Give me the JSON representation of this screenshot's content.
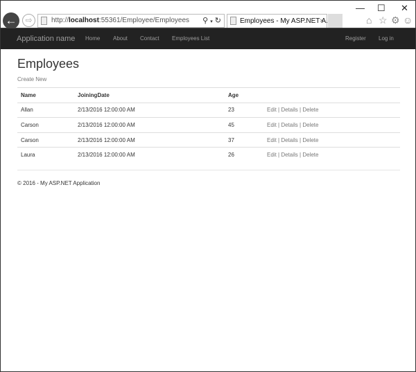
{
  "browser": {
    "url_prefix": "http://",
    "url_host": "localhost",
    "url_rest": ":55361/Employee/Employees",
    "tab_title": "Employees - My ASP.NET A...",
    "search_icon": "search-icon",
    "refresh_icon": "refresh-icon"
  },
  "navbar": {
    "brand": "Application name",
    "links": [
      "Home",
      "About",
      "Contact",
      "Employees List"
    ],
    "right_links": [
      "Register",
      "Log in"
    ]
  },
  "page": {
    "title": "Employees",
    "create_new": "Create New",
    "columns": [
      "Name",
      "JoiningDate",
      "Age"
    ],
    "rows": [
      {
        "name": "Allan",
        "date": "2/13/2016 12:00:00 AM",
        "age": "23"
      },
      {
        "name": "Carson",
        "date": "2/13/2016 12:00:00 AM",
        "age": "45"
      },
      {
        "name": "Carson",
        "date": "2/13/2016 12:00:00 AM",
        "age": "37"
      },
      {
        "name": "Laura",
        "date": "2/13/2016 12:00:00 AM",
        "age": "26"
      }
    ],
    "actions": {
      "edit": "Edit",
      "details": "Details",
      "delete": "Delete",
      "sep": " | "
    },
    "footer": "© 2016 - My ASP.NET Application"
  },
  "colors": {
    "navbar": "#222222",
    "nav_text": "#9d9d9d"
  }
}
